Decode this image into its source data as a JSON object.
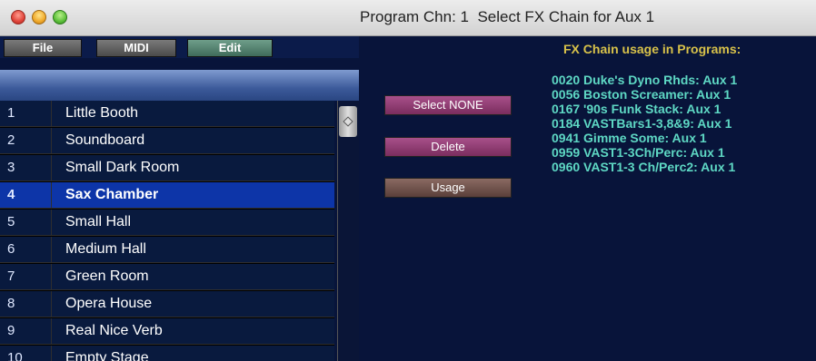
{
  "window": {
    "title": "Program Chn: 1  Select FX Chain for Aux 1"
  },
  "menu": {
    "file": "File",
    "midi": "MIDI",
    "edit": "Edit"
  },
  "list": {
    "rows": [
      {
        "num": "1",
        "name": "Little Booth"
      },
      {
        "num": "2",
        "name": "Soundboard"
      },
      {
        "num": "3",
        "name": "Small Dark Room"
      },
      {
        "num": "4",
        "name": "Sax Chamber"
      },
      {
        "num": "5",
        "name": "Small Hall"
      },
      {
        "num": "6",
        "name": "Medium Hall"
      },
      {
        "num": "7",
        "name": "Green Room"
      },
      {
        "num": "8",
        "name": "Opera House"
      },
      {
        "num": "9",
        "name": "Real Nice Verb"
      },
      {
        "num": "10",
        "name": "Empty Stage"
      }
    ],
    "selected_num": "4"
  },
  "actions": {
    "select_none": "Select NONE",
    "delete": "Delete",
    "usage": "Usage"
  },
  "usage": {
    "title": "FX Chain usage in Programs:",
    "items": [
      "0020  Duke's Dyno Rhds:  Aux 1",
      "0056  Boston Screamer:  Aux 1",
      "0167  '90s Funk Stack:  Aux 1",
      "0184  VASTBars1-3,8&9:  Aux 1",
      "0941  Gimme Some:  Aux 1",
      "0959  VAST1-3Ch/Perc:  Aux 1",
      "0960  VAST1-3 Ch/Perc2:  Aux 1"
    ]
  },
  "colors": {
    "background": "#08143a",
    "selected_row": "#0d35a8",
    "usage_text": "#5ed8c4",
    "usage_title": "#d8c24a"
  }
}
